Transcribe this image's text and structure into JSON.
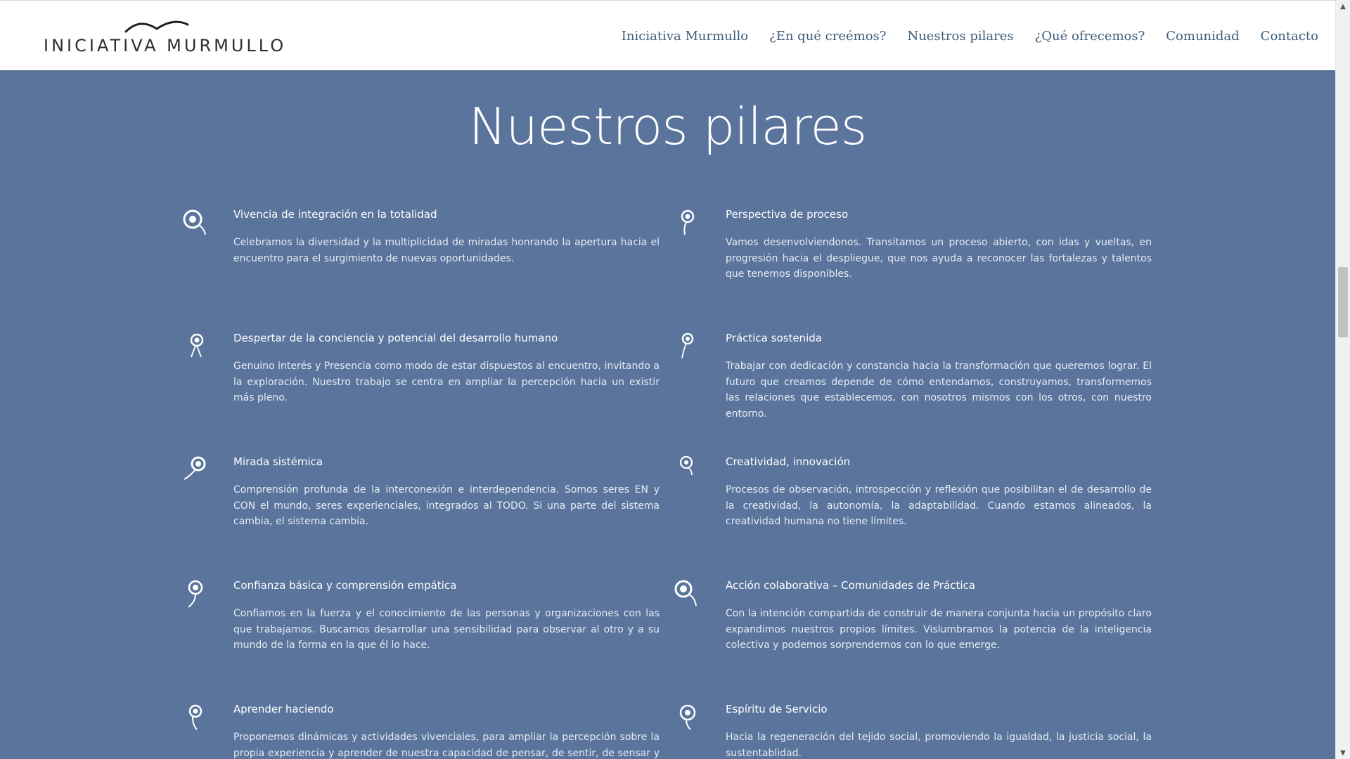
{
  "header": {
    "logo_text": "INICIATIVA MURMULLO",
    "nav": [
      "Iniciativa Murmullo",
      "¿En qué creémos?",
      "Nuestros pilares",
      "¿Qué ofrecemos?",
      "Comunidad",
      "Contacto"
    ]
  },
  "section": {
    "title": "Nuestros pilares",
    "pillars": [
      {
        "title": "Vivencia de integración en la totalidad",
        "text": "Celebramos la diversidad y la multiplicidad de miradas honrando la apertura hacia el encuentro para el surgimiento de nuevas oportunidades.",
        "icon": "circle-dot-icon"
      },
      {
        "title": "Perspectiva de proceso",
        "text": "Vamos desenvolviendonos. Transitamos un proceso abierto, con idas y vueltas, en progresión hacia el despliegue, que nos ayuda a reconocer las fortalezas y talentos que tenemos disponibles.",
        "icon": "circle-dot-icon"
      },
      {
        "title": "Despertar de la conciencia y potencial del desarrollo humano",
        "text": "Genuino interés y Presencia como modo de estar dispuestos al encuentro, invitando a la exploración. Nuestro trabajo se centra en ampliar la percepción hacia un existir más pleno.",
        "icon": "circle-dot-icon"
      },
      {
        "title": "Práctica sostenida",
        "text": "Trabajar con dedicación y constancia hacia la transformación que queremos lograr. El futuro que creamos depende de cómo entendamos, construyamos, transformemos las relaciones que establecemos, con nosotros mismos con los otros, con nuestro entorno.",
        "icon": "circle-dot-icon"
      },
      {
        "title": "Mirada sistémica",
        "text": "Comprensión profunda de la interconexión e interdependencia. Somos seres EN y CON el mundo, seres experienciales, integrados al TODO. Si una parte del sistema cambia, el sistema cambia.",
        "icon": "circle-dot-icon"
      },
      {
        "title": "Creatividad, innovación",
        "text": "Procesos de observación, introspección y reflexión que posibilitan el de desarrollo de la creatividad, la autonomía, la adaptabilidad. Cuando estamos alineados, la creatividad humana no tiene límites.",
        "icon": "circle-dot-icon"
      },
      {
        "title": "Confianza básica y comprensión empática",
        "text": "Confiamos en la fuerza y el conocimiento de las personas y organizaciones con las que trabajamos. Buscamos desarrollar una sensibilidad para observar al otro y a su mundo de la forma en la que él lo hace.",
        "icon": "circle-dot-icon"
      },
      {
        "title": "Acción colaborativa – Comunidades de Práctica",
        "text": "Con la intención compartida de construir de manera conjunta hacia un propósito claro expandimos nuestros propios límites. Vislumbramos la potencia de la inteligencia colectiva y podemos sorprendernos con lo que emerge.",
        "icon": "circle-dot-icon"
      },
      {
        "title": "Aprender haciendo",
        "text": "Proponemos dinámicas y actividades vivenciales, para ampliar la percepción sobre la propia experiencia y aprender de nuestra capacidad de pensar, de sentir, de sensar y de",
        "icon": "circle-dot-icon"
      },
      {
        "title": "Espíritu de Servicio",
        "text": "Hacia la regeneración del tejido social, promoviendo la igualdad, la justicia social, la sustentablidad.",
        "icon": "circle-dot-icon"
      }
    ]
  },
  "colors": {
    "background": "#5a749c",
    "nav_text": "#3e5e7a",
    "header_bg": "#ffffff"
  }
}
